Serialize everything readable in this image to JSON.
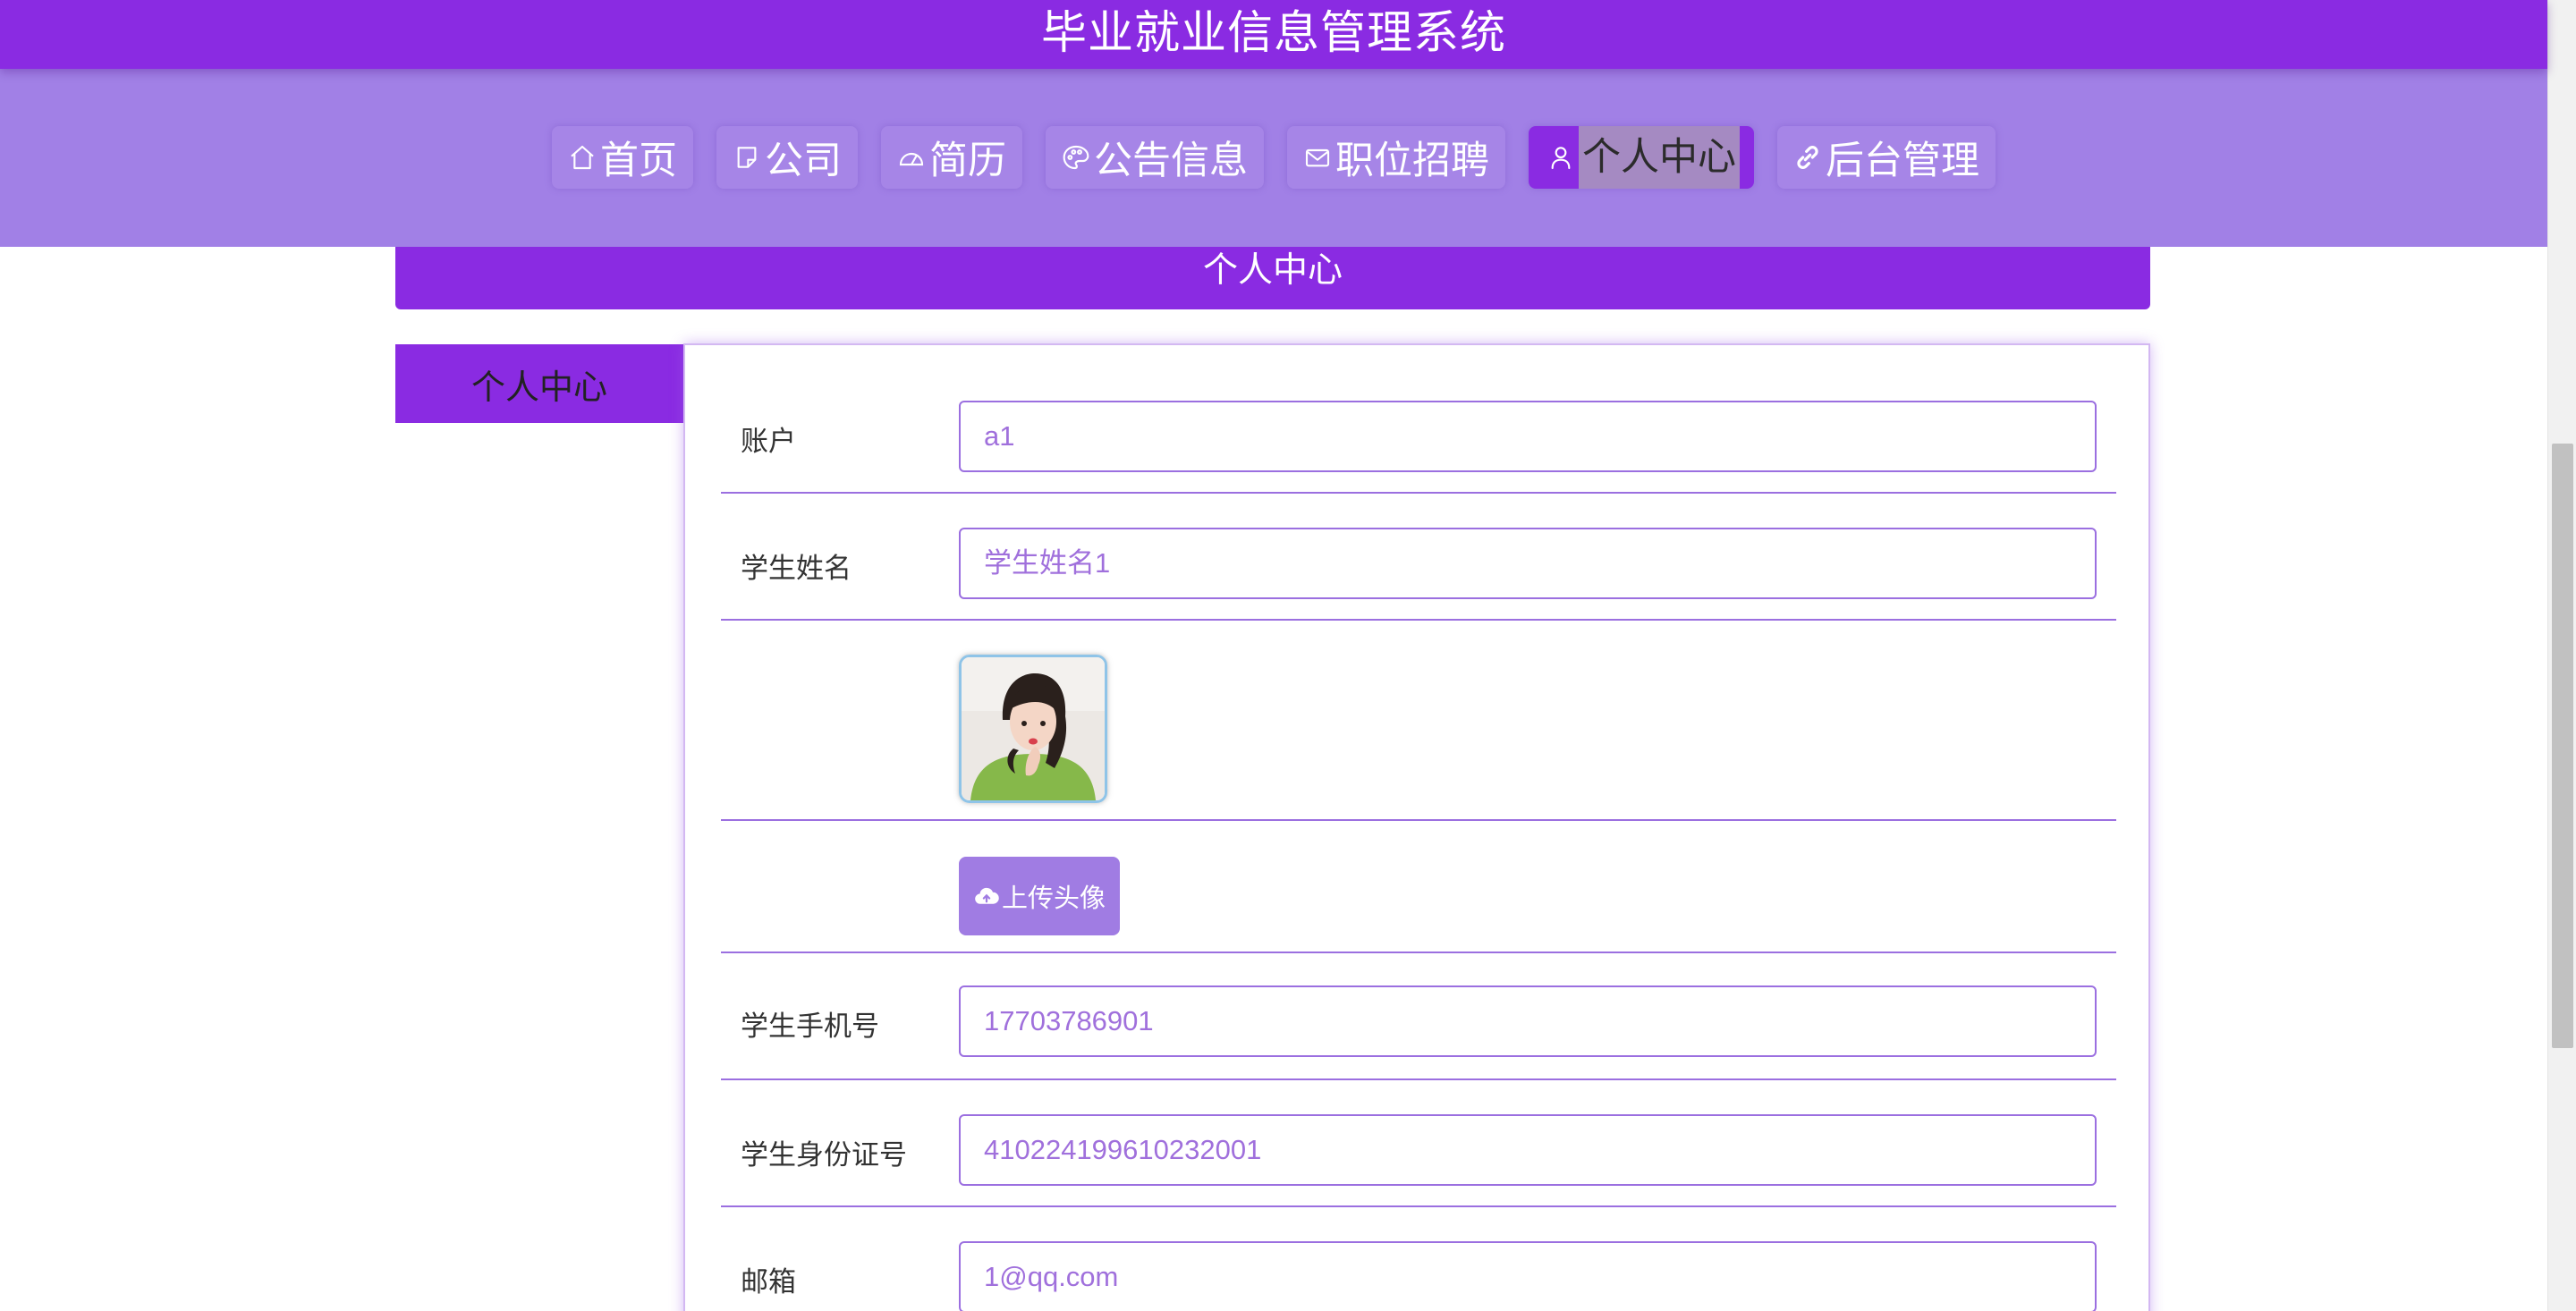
{
  "header": {
    "site_title": "毕业就业信息管理系统"
  },
  "nav": {
    "items": [
      {
        "label": "首页",
        "icon": "home-icon",
        "active": false
      },
      {
        "label": "公司",
        "icon": "note-icon",
        "active": false
      },
      {
        "label": "简历",
        "icon": "gauge-icon",
        "active": false
      },
      {
        "label": "公告信息",
        "icon": "palette-icon",
        "active": false
      },
      {
        "label": "职位招聘",
        "icon": "mail-icon",
        "active": false
      },
      {
        "label": "个人中心",
        "icon": "user-icon",
        "active": true
      },
      {
        "label": "后台管理",
        "icon": "link-icon",
        "active": false
      }
    ]
  },
  "section": {
    "title": "个人中心"
  },
  "side_menu": {
    "items": [
      {
        "label": "个人中心"
      }
    ]
  },
  "form": {
    "account": {
      "label": "账户",
      "value": "a1"
    },
    "student_name": {
      "label": "学生姓名",
      "value": "学生姓名1"
    },
    "avatar": {
      "alt": "avatar-photo"
    },
    "upload": {
      "label": "上传头像",
      "icon": "cloud-upload-icon"
    },
    "phone": {
      "label": "学生手机号",
      "value": "17703786901"
    },
    "id_number": {
      "label": "学生身份证号",
      "value": "410224199610232001"
    },
    "email": {
      "label": "邮箱",
      "value": "1@qq.com"
    }
  },
  "colors": {
    "primary": "#8a2be2",
    "nav_background": "#a180e6",
    "border": "#9b6fe0",
    "input_text": "#a070dc"
  }
}
